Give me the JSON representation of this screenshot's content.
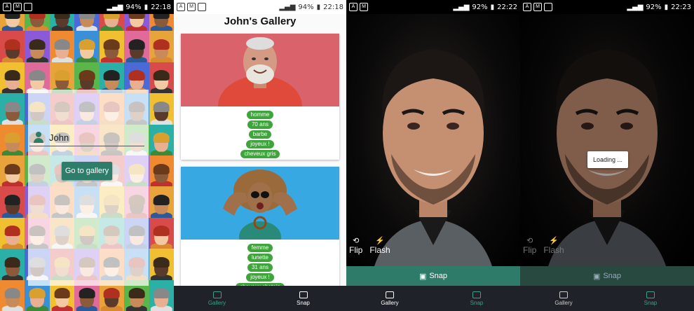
{
  "panels": [
    {
      "status": {
        "battery": "94%",
        "time": "22:18"
      },
      "login": {
        "name_value": "John",
        "button_label": "Go to gallery"
      }
    },
    {
      "status": {
        "battery": "94%",
        "time": "22:18"
      },
      "title": "John's Gallery",
      "cards": [
        {
          "tags": [
            "homme",
            "70 ans",
            "barbe",
            "joyeux !",
            "cheveux gris"
          ]
        },
        {
          "tags": [
            "femme",
            "lunette",
            "31 ans",
            "joyeux !",
            "cheveux chatain"
          ]
        }
      ],
      "nav": {
        "gallery": "Gallery",
        "snap": "Snap"
      }
    },
    {
      "status": {
        "battery": "92%",
        "time": "22:22"
      },
      "controls": {
        "flip": "Flip",
        "flash": "Flash"
      },
      "snap": "Snap",
      "nav": {
        "gallery": "Gallery",
        "snap": "Snap"
      }
    },
    {
      "status": {
        "battery": "92%",
        "time": "22:23"
      },
      "loading": "Loading ...",
      "controls": {
        "flip": "Flip",
        "flash": "Flash"
      },
      "snap": "Snap",
      "nav": {
        "gallery": "Gallery",
        "snap": "Snap"
      }
    }
  ],
  "colors": {
    "accent": "#2e7d6b",
    "tag_green": "#3fa43b",
    "nav_bg": "#1f2229"
  },
  "icons": [
    "user-icon",
    "gallery-icon",
    "camera-icon",
    "flip-camera-icon",
    "flash-icon",
    "snap-icon"
  ]
}
